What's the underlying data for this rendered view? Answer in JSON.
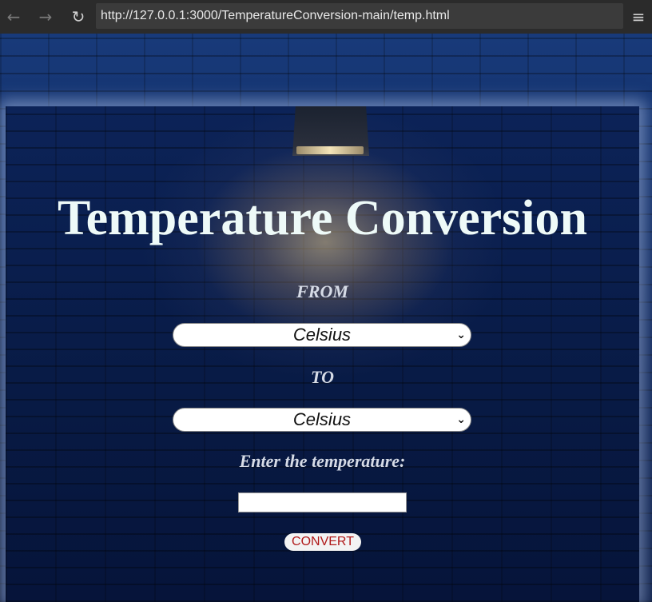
{
  "browser": {
    "url": "http://127.0.0.1:3000/TemperatureConversion-main/temp.html",
    "icons": {
      "back": "back-arrow-icon",
      "forward": "forward-arrow-icon",
      "reload": "reload-icon",
      "menu": "hamburger-menu-icon"
    }
  },
  "page": {
    "title": "Temperature Conversion",
    "from_label": "FROM",
    "from_select": {
      "selected": "Celsius"
    },
    "to_label": "TO",
    "to_select": {
      "selected": "Celsius"
    },
    "enter_label": "Enter the temperature:",
    "temperature_input": {
      "value": "",
      "placeholder": ""
    },
    "convert_button": "CONVERT"
  },
  "colors": {
    "title": "#eefaf8",
    "label": "#d6dbe6",
    "button_text": "#b01818",
    "background": "#0d2456"
  }
}
